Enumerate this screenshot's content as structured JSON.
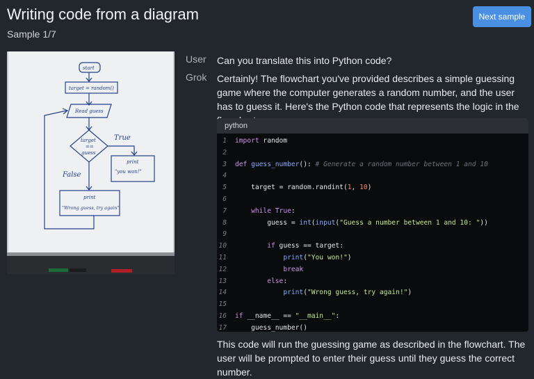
{
  "header": {
    "title": "Writing code from a diagram",
    "subtitle": "Sample 1/7",
    "next_button": "Next sample"
  },
  "conversation": {
    "user_label": "User",
    "user_message": "Can you translate this into Python code?",
    "assistant_label": "Grok",
    "assistant_intro": "Certainly! The flowchart you've provided describes a simple guessing game where the computer generates a random number, and the user has to guess it. Here's the Python code that represents the logic in the flowchart:",
    "code_language": "python",
    "assistant_outro": "This code will run the guessing game as described in the flowchart. The user will be prompted to enter their guess until they guess the correct number."
  },
  "whiteboard": {
    "start": "start",
    "assign": "target = random()",
    "read": "Read guess",
    "decision_line1": "target",
    "decision_line2": "==",
    "decision_line3": "guess",
    "true_label": "True",
    "false_label": "False",
    "print_true_1": "print",
    "print_true_2": "\"you won!\"",
    "print_false_1": "print",
    "print_false_2": "\"Wrong guess, try again\""
  },
  "code_lines": [
    {
      "n": "1",
      "t": [
        [
          "k",
          "import"
        ],
        [
          "p",
          " random"
        ]
      ]
    },
    {
      "n": "2",
      "t": []
    },
    {
      "n": "3",
      "t": [
        [
          "k",
          "def"
        ],
        [
          "p",
          " "
        ],
        [
          "f",
          "guess_number"
        ],
        [
          "p",
          "(): "
        ],
        [
          "c",
          "# Generate a random number between 1 and 10"
        ]
      ]
    },
    {
      "n": "4",
      "t": []
    },
    {
      "n": "5",
      "t": [
        [
          "p",
          "    target = random.randint("
        ],
        [
          "n",
          "1"
        ],
        [
          "p",
          ", "
        ],
        [
          "n",
          "10"
        ],
        [
          "p",
          ")"
        ]
      ]
    },
    {
      "n": "6",
      "t": []
    },
    {
      "n": "7",
      "t": [
        [
          "p",
          "    "
        ],
        [
          "k",
          "while"
        ],
        [
          "p",
          " "
        ],
        [
          "k",
          "True"
        ],
        [
          "p",
          ":"
        ]
      ]
    },
    {
      "n": "8",
      "t": [
        [
          "p",
          "        guess = "
        ],
        [
          "f",
          "int"
        ],
        [
          "p",
          "("
        ],
        [
          "f",
          "input"
        ],
        [
          "p",
          "("
        ],
        [
          "s",
          "\"Guess a number between 1 and 10: \""
        ],
        [
          "p",
          "))"
        ]
      ]
    },
    {
      "n": "9",
      "t": []
    },
    {
      "n": "10",
      "t": [
        [
          "p",
          "        "
        ],
        [
          "k",
          "if"
        ],
        [
          "p",
          " guess == target:"
        ]
      ]
    },
    {
      "n": "11",
      "t": [
        [
          "p",
          "            "
        ],
        [
          "f",
          "print"
        ],
        [
          "p",
          "("
        ],
        [
          "s",
          "\"You won!\""
        ],
        [
          "p",
          ")"
        ]
      ]
    },
    {
      "n": "12",
      "t": [
        [
          "p",
          "            "
        ],
        [
          "k",
          "break"
        ]
      ]
    },
    {
      "n": "13",
      "t": [
        [
          "p",
          "        "
        ],
        [
          "k",
          "else"
        ],
        [
          "p",
          ":"
        ]
      ]
    },
    {
      "n": "14",
      "t": [
        [
          "p",
          "            "
        ],
        [
          "f",
          "print"
        ],
        [
          "p",
          "("
        ],
        [
          "s",
          "\"Wrong guess, try again!\""
        ],
        [
          "p",
          ")"
        ]
      ]
    },
    {
      "n": "15",
      "t": []
    },
    {
      "n": "16",
      "t": [
        [
          "k",
          "if"
        ],
        [
          "p",
          " __name__ == "
        ],
        [
          "s",
          "\"__main__\""
        ],
        [
          "p",
          ":"
        ]
      ]
    },
    {
      "n": "17",
      "t": [
        [
          "p",
          "    guess_number()"
        ]
      ]
    }
  ]
}
